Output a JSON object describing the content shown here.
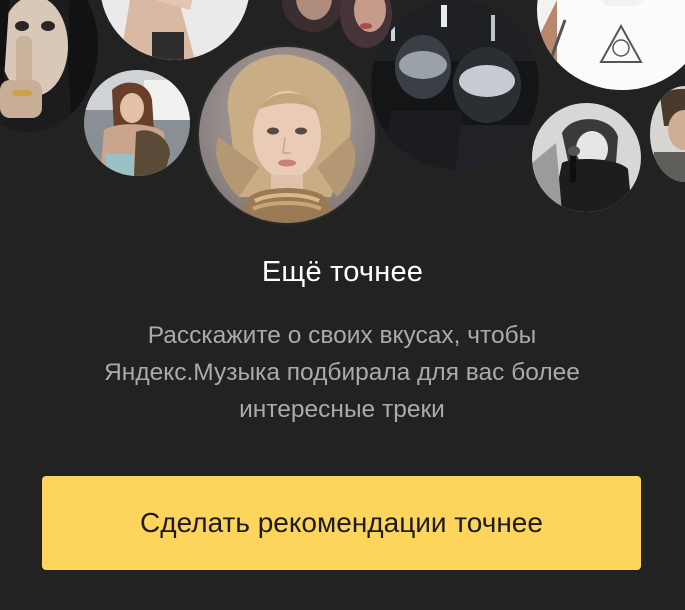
{
  "promo": {
    "title": "Ещё точнее",
    "description_lines": [
      "Расскажите о своих вкусах, чтобы",
      "Яндекс.Музыка подбирала для вас более",
      "интересные треки"
    ],
    "cta_label": "Сделать рекомендации точнее"
  },
  "colors": {
    "background": "#222222",
    "title": "#ffffff",
    "description": "#aaaaaa",
    "cta_background": "#fdd55d",
    "cta_text": "#1b1b1b"
  }
}
